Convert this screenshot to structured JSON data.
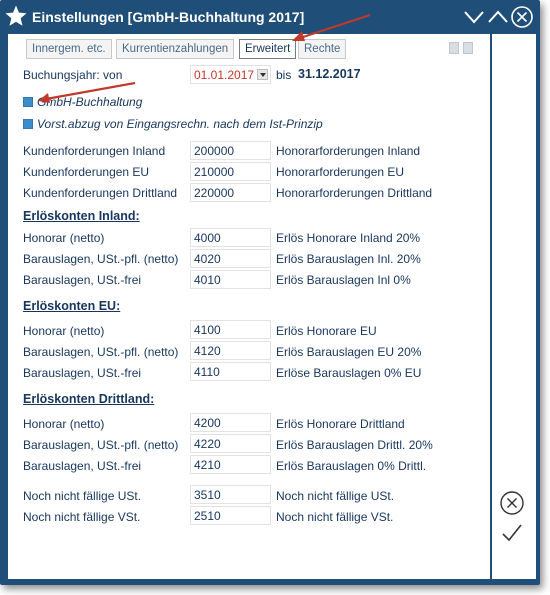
{
  "window": {
    "title": "Einstellungen [GmbH-Buchhaltung 2017]"
  },
  "tabs": [
    "Innergem. etc.",
    "Kurrentienzahlungen",
    "Erweitert",
    "Rechte"
  ],
  "booking_year": {
    "label": "Buchungsjahr: von",
    "from": "01.01.2017",
    "bis_label": "bis",
    "to": "31.12.2017"
  },
  "checkboxes": {
    "gmbh": "GmbH-Buchhaltung",
    "vorst": "Vorst.abzug von Eingangsrechn. nach dem Ist-Prinzip"
  },
  "receivables": [
    {
      "label": "Kundenforderungen Inland",
      "value": "200000",
      "desc": "Honorarforderungen Inland"
    },
    {
      "label": "Kundenforderungen EU",
      "value": "210000",
      "desc": "Honorarforderungen EU"
    },
    {
      "label": "Kundenforderungen Drittland",
      "value": "220000",
      "desc": "Honorarforderungen Drittland"
    }
  ],
  "inland": {
    "title": "Erlöskonten Inland:",
    "rows": [
      {
        "label": "Honorar (netto)",
        "value": "4000",
        "desc": "Erlös Honorare Inland 20%"
      },
      {
        "label": "Barauslagen, USt.-pfl. (netto)",
        "value": "4020",
        "desc": "Erlös Barauslagen Inl. 20%"
      },
      {
        "label": "Barauslagen, USt.-frei",
        "value": "4010",
        "desc": "Erlös Barauslagen Inl 0%"
      }
    ]
  },
  "eu": {
    "title": "Erlöskonten EU:",
    "rows": [
      {
        "label": "Honorar (netto)",
        "value": "4100",
        "desc": "Erlös Honorare EU"
      },
      {
        "label": "Barauslagen, USt.-pfl. (netto)",
        "value": "4120",
        "desc": "Erlös Barauslagen EU 20%"
      },
      {
        "label": "Barauslagen, USt.-frei",
        "value": "4110",
        "desc": "Erlöse Barauslagen 0% EU"
      }
    ]
  },
  "drittland": {
    "title": "Erlöskonten Drittland:",
    "rows": [
      {
        "label": "Honorar (netto)",
        "value": "4200",
        "desc": "Erlös Honorare Drittland"
      },
      {
        "label": "Barauslagen, USt.-pfl. (netto)",
        "value": "4220",
        "desc": "Erlös Barauslagen Drittl. 20%"
      },
      {
        "label": "Barauslagen, USt.-frei",
        "value": "4210",
        "desc": "Erlös Barauslagen 0% Drittl."
      }
    ]
  },
  "tax": [
    {
      "label": "Noch nicht fällige USt.",
      "value": "3510",
      "desc": "Noch nicht fällige USt."
    },
    {
      "label": "Noch nicht fällige VSt.",
      "value": "2510",
      "desc": "Noch nicht fällige VSt."
    }
  ]
}
